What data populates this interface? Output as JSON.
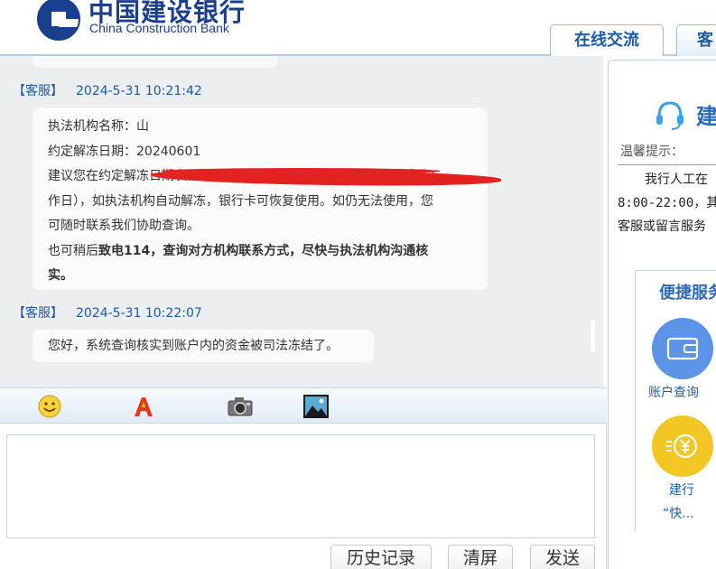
{
  "header": {
    "brand_cn": "中国建设银行",
    "brand_en": "China Construction Bank",
    "tabs": [
      {
        "label": "在线交流",
        "active": true
      },
      {
        "label": "客"
      }
    ],
    "brand_color": "#1b3f8f"
  },
  "chat": {
    "messages": [
      {
        "sender": "【客服】",
        "time": "2024-5-31 10:21:42",
        "lines": [
          "执法机构名称：山",
          "约定解冻日期：20240601",
          "建议您在约定解冻日期次日尝试使用账户（如遇非工作日，会顺延至工",
          "作日），如执法机构自动解冻，银行卡可恢复使用。如仍无法使用，您",
          "可随时联系我们协助查询。"
        ],
        "normal_prefix": "也可稍后",
        "bold_line": "致电114，查询对方机构联系方式，尽快与执法机构沟通核",
        "bold_tail": "实。"
      },
      {
        "sender": "【客服】",
        "time": "2024-5-31 10:22:07",
        "text": "您好，系统查询核实到账户内的资金被司法冻结了。"
      }
    ]
  },
  "toolbar": {
    "icons": [
      "smiley-icon",
      "font-icon",
      "camera-icon",
      "image-icon"
    ]
  },
  "input": {
    "value": "",
    "placeholder": ""
  },
  "buttons": {
    "history": "历史记录",
    "clear": "清屏",
    "send": "发送"
  },
  "right_panel": {
    "title": "建",
    "tip_label": "温馨提示：",
    "tip_lines": [
      "我行人工在",
      "8:00-22:00，其",
      "客服或留言服务"
    ],
    "quick_title": "便捷服务",
    "services": [
      {
        "label": "账户查询",
        "color": "#5b93e6"
      },
      {
        "label": "建行",
        "sub": "“快...",
        "color": "#f2c623"
      }
    ]
  }
}
